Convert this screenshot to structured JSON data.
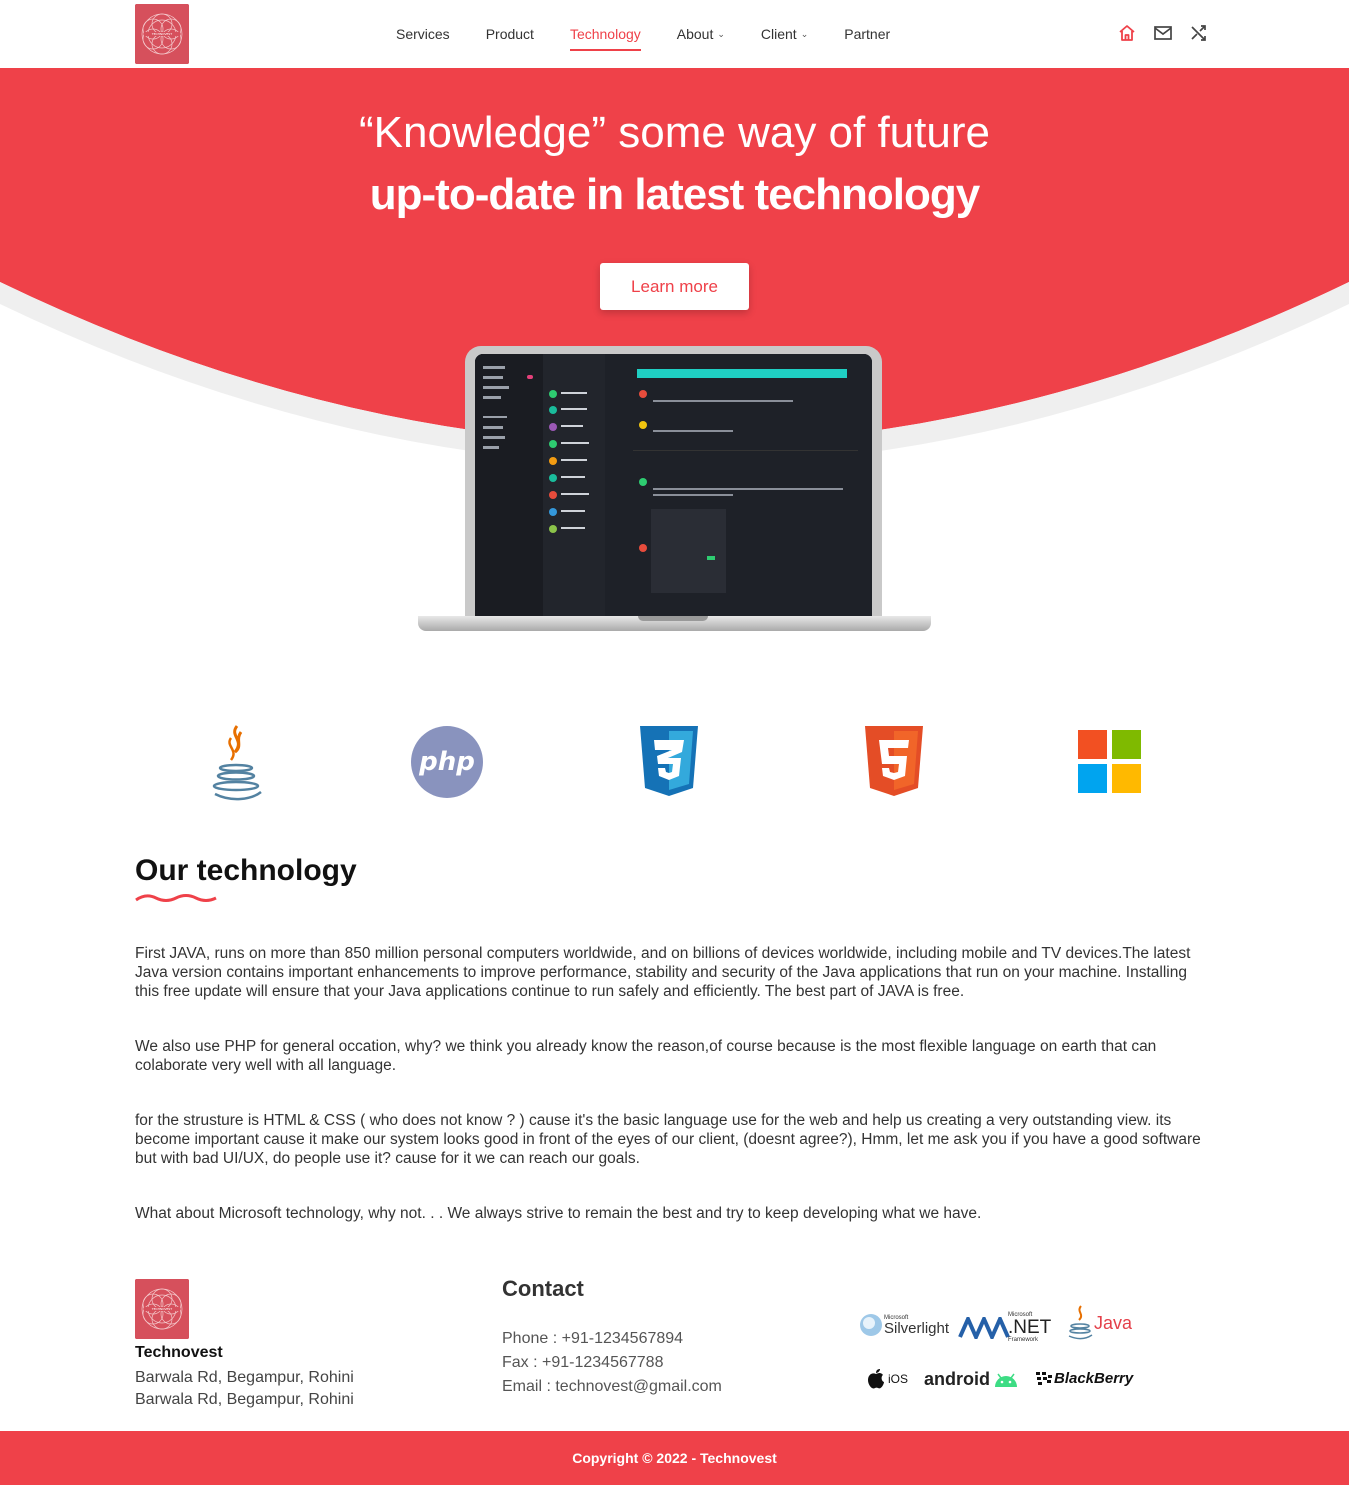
{
  "nav": {
    "links": [
      {
        "label": "Services"
      },
      {
        "label": "Product"
      },
      {
        "label": "Technology"
      },
      {
        "label": "About"
      },
      {
        "label": "Client"
      },
      {
        "label": "Partner"
      }
    ],
    "icons": [
      "home-icon",
      "mail-icon",
      "shuffle-icon"
    ]
  },
  "hero": {
    "line1": "“Knowledge” some way of future",
    "line2": "up-to-date in latest technology",
    "button": "Learn more"
  },
  "tech_logos": [
    "java-logo",
    "php-logo",
    "css3-logo",
    "html5-logo",
    "microsoft-logo"
  ],
  "php_text": "php",
  "section": {
    "title": "Our technology",
    "paragraphs": [
      "First JAVA, runs on more than 850 million personal computers worldwide, and on billions of devices worldwide, including mobile and TV devices.The latest Java version contains important enhancements to improve performance, stability and security of the Java applications that run on your machine. Installing this free update will ensure that your Java applications continue to run safely and efficiently. The best part of JAVA is free.",
      "We also use PHP for general occation, why? we think you already know the reason,of course because is the most flexible language on earth that can colaborate very well with all language.",
      "for the strusture is HTML & CSS ( who does not know ? ) cause it's the basic language use for the web and help us creating a very outstanding view. its become important cause it make our system looks good in front of the eyes of our client, (doesnt agree?), Hmm, let me ask you if you have a good software but with bad UI/UX, do people use it? cause for it we can reach our goals.",
      "What about Microsoft technology, why not. . . We always strive to remain the best and try to keep developing what we have."
    ]
  },
  "footer": {
    "company": "Technovest",
    "address1": "Barwala Rd, Begampur, Rohini",
    "address2": "Barwala Rd, Begampur, Rohini",
    "contact_title": "Contact",
    "phone": "Phone : +91-1234567894",
    "fax": "Fax : +91-1234567788",
    "email": "Email : technovest@gmail.com",
    "brands": {
      "silverlight": "Silverlight",
      "microsoft_small": "Microsoft",
      "dotnet": ".NET",
      "framework": "Framework",
      "java": "Java",
      "ios": "iOS",
      "android": "android",
      "blackberry": "BlackBerry"
    },
    "copyright": "Copyright © 2022 - Technovest"
  },
  "colors": {
    "accent": "#ef4149",
    "logo_bg": "#d6505c"
  }
}
